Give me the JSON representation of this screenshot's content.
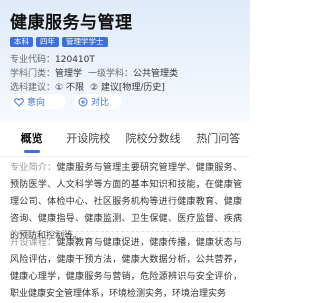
{
  "major": {
    "title": "健康服务与管理",
    "tags": [
      "本科",
      "四年",
      "管理学学士"
    ]
  },
  "info": {
    "code_label": "专业代码：",
    "code": "120410T",
    "category_label": "学科门类：",
    "category": "管理学",
    "subject_label": "一级学科：",
    "subject": "公共管理类",
    "requirement_label": "选科建议：",
    "requirement_1": "① 不限",
    "requirement_2": "② 建议[物理/历史]"
  },
  "actions": {
    "intent_label": "意向",
    "compare_label": "对比"
  },
  "tabs": [
    "概览",
    "开设院校",
    "院校分数线",
    "热门问答"
  ],
  "overview": {
    "intro_label": "专业简介：",
    "intro_text": "健康服务与管理主要研究管理学、健康服务、预防医学、人文科学等方面的基本知识和技能，在健康管理公司、体检中心、社区服务机构等进行健康教育、健康咨询、健康指导、健康监测、卫生保健、医疗监督、疾病的预防和控制等。",
    "courses_label": "开设课程：",
    "courses_text": "健康教育与健康促进，健康传播，健康状态与风险评估，健康干预方法，健康大数据分析，公共营养，健康心理学，健康服务与营销，危险源辨识与安全评价，职业健康安全管理体系，环境检测实务，环境治理实务"
  },
  "colors": {
    "accent": "#3f6fd8",
    "header_bg": "#e3edfa"
  }
}
